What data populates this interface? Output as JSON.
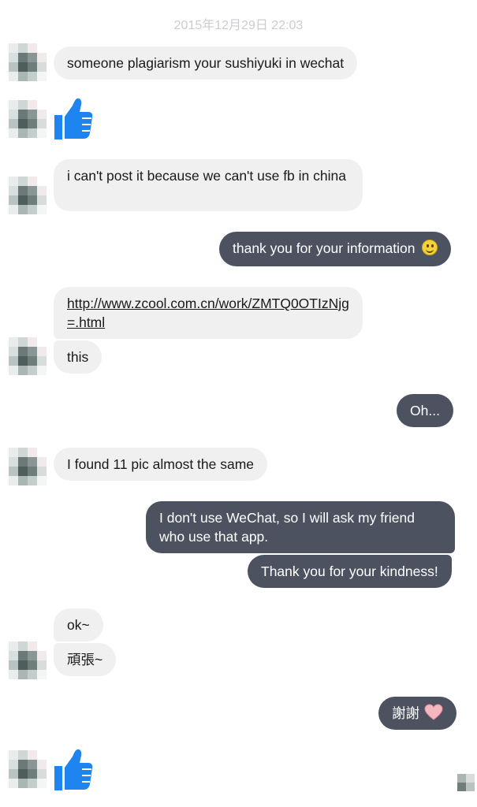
{
  "header": {
    "timestamp": "2015年12月29日 22:03"
  },
  "messages": {
    "m1": "someone plagiarism your sushiyuki in wechat",
    "m2": "i can't post it because we can't use fb in china",
    "m3": "thank you for your information",
    "m4": "http://www.zcool.com.cn/work/ZMTQ0OTIzNjg=.html",
    "m5": "this",
    "m6": "Oh...",
    "m7": "I found 11 pic almost the same",
    "m8": "I don't use WeChat, so I will ask my friend who use that app.",
    "m9": "Thank you for your kindness!",
    "m10": "ok~",
    "m11": "頑張~",
    "m12": "謝謝"
  },
  "icons": {
    "like": "thumbs-up-icon",
    "smile": "smiling-face-emoji",
    "heart": "heart-emoji",
    "avatar": "pixelated-avatar"
  },
  "colors": {
    "incoming_bubble": "#f1f0f0",
    "outgoing_bubble": "#4c5260",
    "like_blue": "#1e84f0",
    "timestamp": "#c9cdd3"
  }
}
